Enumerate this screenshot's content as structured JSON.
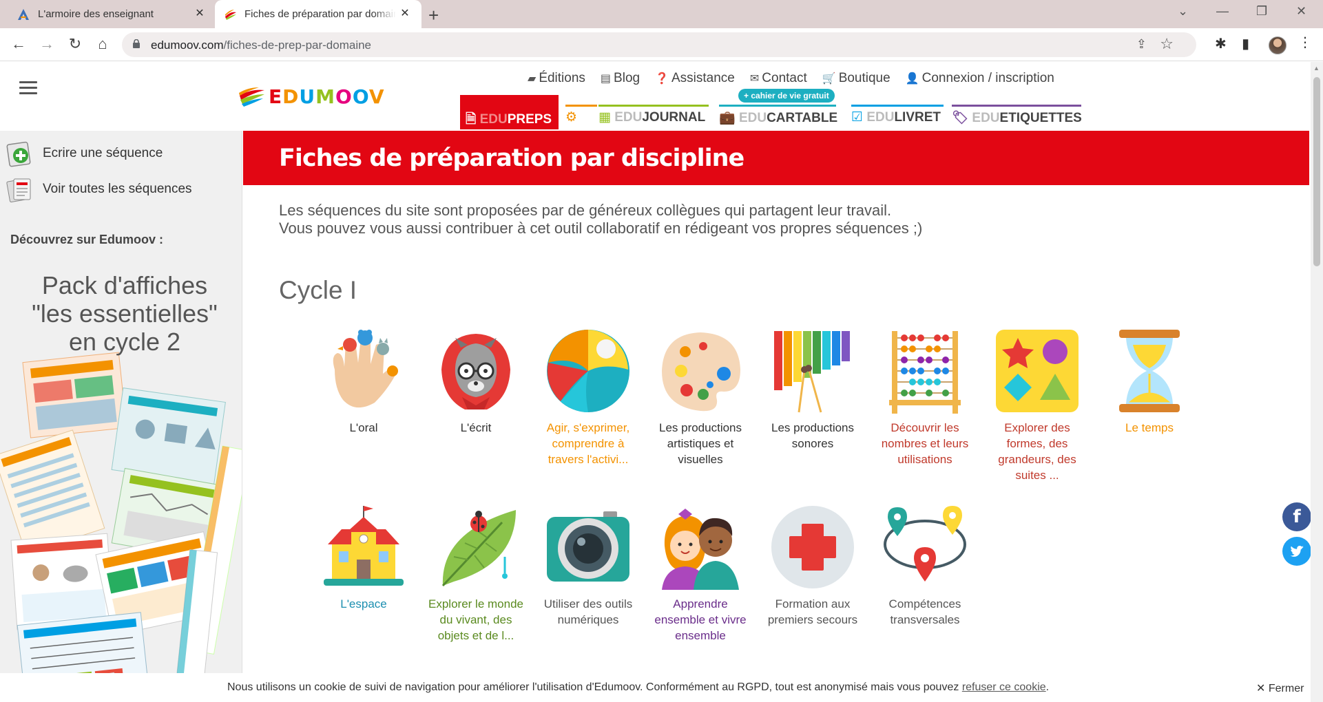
{
  "browser": {
    "tabs": [
      {
        "title": "L'armoire des enseignant"
      },
      {
        "title": "Fiches de préparation par domaine"
      }
    ],
    "url_host": "edumoov.com",
    "url_path": "/fiches-de-prep-par-domaine"
  },
  "site": {
    "logo_text": "EDUMOOV",
    "top_nav": [
      {
        "icon": "book-icon",
        "label": "Éditions"
      },
      {
        "icon": "newspaper-icon",
        "label": "Blog"
      },
      {
        "icon": "question-circle-icon",
        "label": "Assistance"
      },
      {
        "icon": "envelope-icon",
        "label": "Contact"
      },
      {
        "icon": "cart-icon",
        "label": "Boutique"
      },
      {
        "icon": "user-icon",
        "label": "Connexion / inscription"
      }
    ],
    "products": [
      {
        "prefix": "EDU",
        "name": "PREPS",
        "color": "#e20613"
      },
      {
        "prefix": "",
        "name": "",
        "color": "#f39200"
      },
      {
        "prefix": "EDU",
        "name": "JOURNAL",
        "color": "#95c11f"
      },
      {
        "prefix": "EDU",
        "name": "CARTABLE",
        "color": "#1dafc1"
      },
      {
        "prefix": "EDU",
        "name": "LIVRET",
        "color": "#009fe3"
      },
      {
        "prefix": "EDU",
        "name": "ETIQUETTES",
        "color": "#7b4f9d"
      }
    ],
    "cartable_badge": "+ cahier de vie gratuit"
  },
  "sidebar": {
    "links": [
      {
        "label": "Ecrire une séquence"
      },
      {
        "label": "Voir toutes les séquences"
      }
    ],
    "discover": "Découvrez sur Edumoov :",
    "promo_title": [
      "Pack d'affiches",
      "\"les essentielles\"",
      "en cycle 2"
    ]
  },
  "main": {
    "banner_title": "Fiches de préparation par discipline",
    "intro_line1": "Les séquences du site sont proposées par de généreux collègues qui partagent leur travail.",
    "intro_line2": "Vous pouvez vous aussi contribuer à cet outil collaboratif en rédigeant vos propres séquences ;)",
    "cycle_title": "Cycle I",
    "domains": [
      {
        "label": "L'oral",
        "color": "#333333",
        "icon": "finger-puppets-icon"
      },
      {
        "label": "L'écrit",
        "color": "#333333",
        "icon": "wolf-reader-icon"
      },
      {
        "label": "Agir, s'exprimer, comprendre à travers l'activi...",
        "color": "#f39200",
        "icon": "beach-ball-icon"
      },
      {
        "label": "Les productions artistiques et visuelles",
        "color": "#333333",
        "icon": "palette-icon"
      },
      {
        "label": "Les productions sonores",
        "color": "#333333",
        "icon": "xylophone-icon"
      },
      {
        "label": "Découvrir les nombres et leurs utilisations",
        "color": "#c0392b",
        "icon": "abacus-icon"
      },
      {
        "label": "Explorer des formes, des grandeurs, des suites ...",
        "color": "#c0392b",
        "icon": "shapes-icon"
      },
      {
        "label": "Le temps",
        "color": "#f39200",
        "icon": "hourglass-icon"
      },
      {
        "label": "L'espace",
        "color": "#1c8fb0",
        "icon": "school-icon"
      },
      {
        "label": "Explorer le monde du vivant, des objets et de l...",
        "color": "#5a8a1f",
        "icon": "leaf-ladybug-icon"
      },
      {
        "label": "Utiliser des outils numériques",
        "color": "#555555",
        "icon": "camera-icon"
      },
      {
        "label": "Apprendre ensemble et vivre ensemble",
        "color": "#6a2d8a",
        "icon": "children-icon"
      },
      {
        "label": "Formation aux premiers secours",
        "color": "#555555",
        "icon": "red-cross-icon"
      },
      {
        "label": "Compétences transversales",
        "color": "#555555",
        "icon": "map-pins-icon"
      }
    ]
  },
  "social": {
    "facebook": "f",
    "twitter": "t"
  },
  "cookie": {
    "message": "Nous utilisons un cookie de suivi de navigation pour améliorer l'utilisation d'Edumoov. Conformément au RGPD, tout est anonymisé mais vous pouvez",
    "link": "refuser ce cookie",
    "end": ".",
    "close": "Fermer"
  }
}
